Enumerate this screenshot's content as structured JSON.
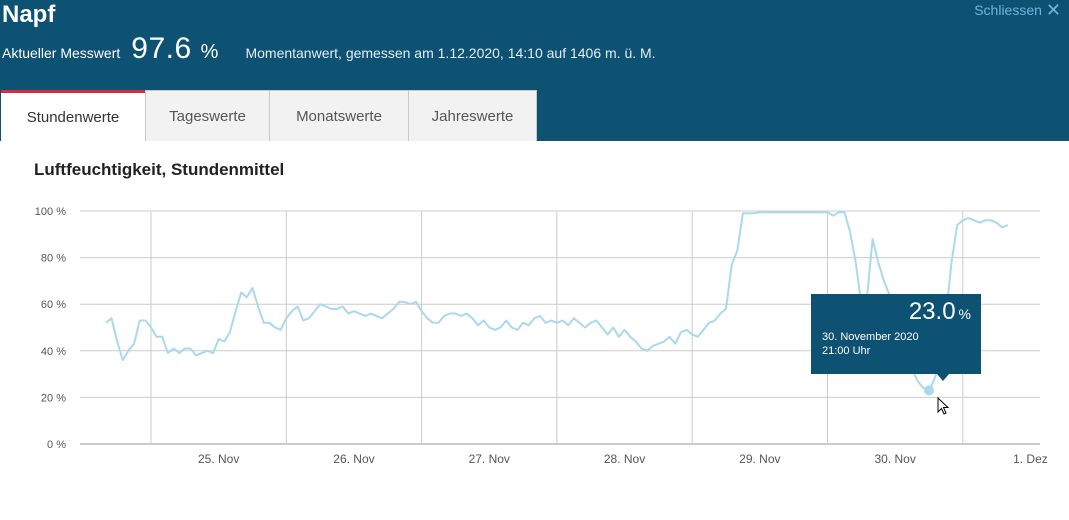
{
  "header": {
    "station": "Napf",
    "close_label": "Schliessen",
    "close_icon": "close-x-icon",
    "measure_label": "Aktueller Messwert",
    "measure_value": "97.6",
    "measure_unit": "%",
    "measure_note": "Momentanwert, gemessen am 1.12.2020, 14:10 auf 1406 m. ü. M."
  },
  "tabs": [
    {
      "label": "Stundenwerte",
      "active": true
    },
    {
      "label": "Tageswerte",
      "active": false
    },
    {
      "label": "Monatswerte",
      "active": false
    },
    {
      "label": "Jahreswerte",
      "active": false
    }
  ],
  "colors": {
    "header_bg": "#0d5173",
    "active_tab_accent": "#d42e3a",
    "series_line": "#aad8ee",
    "grid": "#cccccc"
  },
  "tooltip": {
    "value": "23.0",
    "unit": "%",
    "date": "30. November 2020",
    "time": "21:00 Uhr"
  },
  "chart_data": {
    "type": "line",
    "title": "Luftfeuchtigkeit, Stundenmittel",
    "xlabel": "",
    "ylabel": "",
    "ylim": [
      0,
      100
    ],
    "yticks": [
      "0 %",
      "20 %",
      "40 %",
      "60 %",
      "80 %",
      "100 %"
    ],
    "x_tick_labels": [
      "25. Nov",
      "26. Nov",
      "27. Nov",
      "28. Nov",
      "29. Nov",
      "30. Nov",
      "1. Dez"
    ],
    "x_units": "hours since 24. Nov 2020 00:00",
    "xlim": [
      16,
      182
    ],
    "grid": true,
    "series": [
      {
        "values": [
          [
            16,
            52
          ],
          [
            17,
            54
          ],
          [
            18,
            44
          ],
          [
            19,
            36
          ],
          [
            20,
            40
          ],
          [
            21,
            43
          ],
          [
            22,
            53
          ],
          [
            23,
            53
          ],
          [
            24,
            50
          ],
          [
            25,
            46
          ],
          [
            26,
            46
          ],
          [
            27,
            39
          ],
          [
            28,
            41
          ],
          [
            29,
            39
          ],
          [
            30,
            41
          ],
          [
            31,
            41
          ],
          [
            32,
            38
          ],
          [
            33,
            39
          ],
          [
            34,
            40
          ],
          [
            35,
            39
          ],
          [
            36,
            45
          ],
          [
            37,
            44
          ],
          [
            38,
            48
          ],
          [
            39,
            57
          ],
          [
            40,
            65
          ],
          [
            41,
            63
          ],
          [
            42,
            67
          ],
          [
            43,
            59
          ],
          [
            44,
            52
          ],
          [
            45,
            52
          ],
          [
            46,
            50
          ],
          [
            47,
            49
          ],
          [
            48,
            54
          ],
          [
            49,
            57
          ],
          [
            50,
            59
          ],
          [
            51,
            53
          ],
          [
            52,
            54
          ],
          [
            53,
            57
          ],
          [
            54,
            60
          ],
          [
            55,
            59
          ],
          [
            56,
            58
          ],
          [
            57,
            58
          ],
          [
            58,
            59
          ],
          [
            59,
            56
          ],
          [
            60,
            57
          ],
          [
            61,
            56
          ],
          [
            62,
            55
          ],
          [
            63,
            56
          ],
          [
            64,
            55
          ],
          [
            65,
            54
          ],
          [
            66,
            56
          ],
          [
            67,
            58
          ],
          [
            68,
            61
          ],
          [
            69,
            61
          ],
          [
            70,
            60
          ],
          [
            71,
            61
          ],
          [
            72,
            57
          ],
          [
            73,
            54
          ],
          [
            74,
            52
          ],
          [
            75,
            52
          ],
          [
            76,
            55
          ],
          [
            77,
            56
          ],
          [
            78,
            56
          ],
          [
            79,
            55
          ],
          [
            80,
            56
          ],
          [
            81,
            54
          ],
          [
            82,
            51
          ],
          [
            83,
            53
          ],
          [
            84,
            50
          ],
          [
            85,
            49
          ],
          [
            86,
            50
          ],
          [
            87,
            53
          ],
          [
            88,
            50
          ],
          [
            89,
            49
          ],
          [
            90,
            52
          ],
          [
            91,
            51
          ],
          [
            92,
            54
          ],
          [
            93,
            55
          ],
          [
            94,
            52
          ],
          [
            95,
            53
          ],
          [
            96,
            52
          ],
          [
            97,
            53
          ],
          [
            98,
            51
          ],
          [
            99,
            54
          ],
          [
            100,
            52
          ],
          [
            101,
            50
          ],
          [
            102,
            52
          ],
          [
            103,
            53
          ],
          [
            104,
            50
          ],
          [
            105,
            47
          ],
          [
            106,
            50
          ],
          [
            107,
            46
          ],
          [
            108,
            49
          ],
          [
            109,
            46
          ],
          [
            110,
            44
          ],
          [
            111,
            41
          ],
          [
            112,
            40
          ],
          [
            113,
            42
          ],
          [
            114,
            43
          ],
          [
            115,
            44
          ],
          [
            116,
            46
          ],
          [
            117,
            43
          ],
          [
            118,
            48
          ],
          [
            119,
            49
          ],
          [
            120,
            47
          ],
          [
            121,
            46
          ],
          [
            122,
            49
          ],
          [
            123,
            52
          ],
          [
            124,
            53
          ],
          [
            125,
            56
          ],
          [
            126,
            58
          ],
          [
            127,
            77
          ],
          [
            128,
            83
          ],
          [
            129,
            99
          ],
          [
            130,
            99
          ],
          [
            131,
            99
          ],
          [
            132,
            99.5
          ],
          [
            133,
            99.5
          ],
          [
            134,
            99.5
          ],
          [
            135,
            99.5
          ],
          [
            136,
            99.5
          ],
          [
            137,
            99.5
          ],
          [
            138,
            99.5
          ],
          [
            139,
            99.5
          ],
          [
            140,
            99.5
          ],
          [
            141,
            99.5
          ],
          [
            142,
            99.5
          ],
          [
            143,
            99.5
          ],
          [
            144,
            99.5
          ],
          [
            145,
            98
          ],
          [
            146,
            99.5
          ],
          [
            147,
            99.5
          ],
          [
            148,
            91
          ],
          [
            149,
            78
          ],
          [
            150,
            60
          ],
          [
            151,
            63
          ],
          [
            152,
            88
          ],
          [
            153,
            78
          ],
          [
            154,
            70
          ],
          [
            155,
            64
          ],
          [
            156,
            58
          ],
          [
            157,
            50
          ],
          [
            158,
            40
          ],
          [
            159,
            32
          ],
          [
            160,
            27
          ],
          [
            161,
            24
          ],
          [
            162,
            23
          ],
          [
            163,
            28
          ],
          [
            164,
            38
          ],
          [
            165,
            55
          ],
          [
            166,
            78
          ],
          [
            167,
            94
          ],
          [
            168,
            96
          ],
          [
            169,
            97
          ],
          [
            170,
            96
          ],
          [
            171,
            95
          ],
          [
            172,
            96
          ],
          [
            173,
            96
          ],
          [
            174,
            95
          ],
          [
            175,
            93
          ],
          [
            176,
            94
          ]
        ]
      }
    ],
    "highlight_point": [
      162,
      23
    ]
  }
}
